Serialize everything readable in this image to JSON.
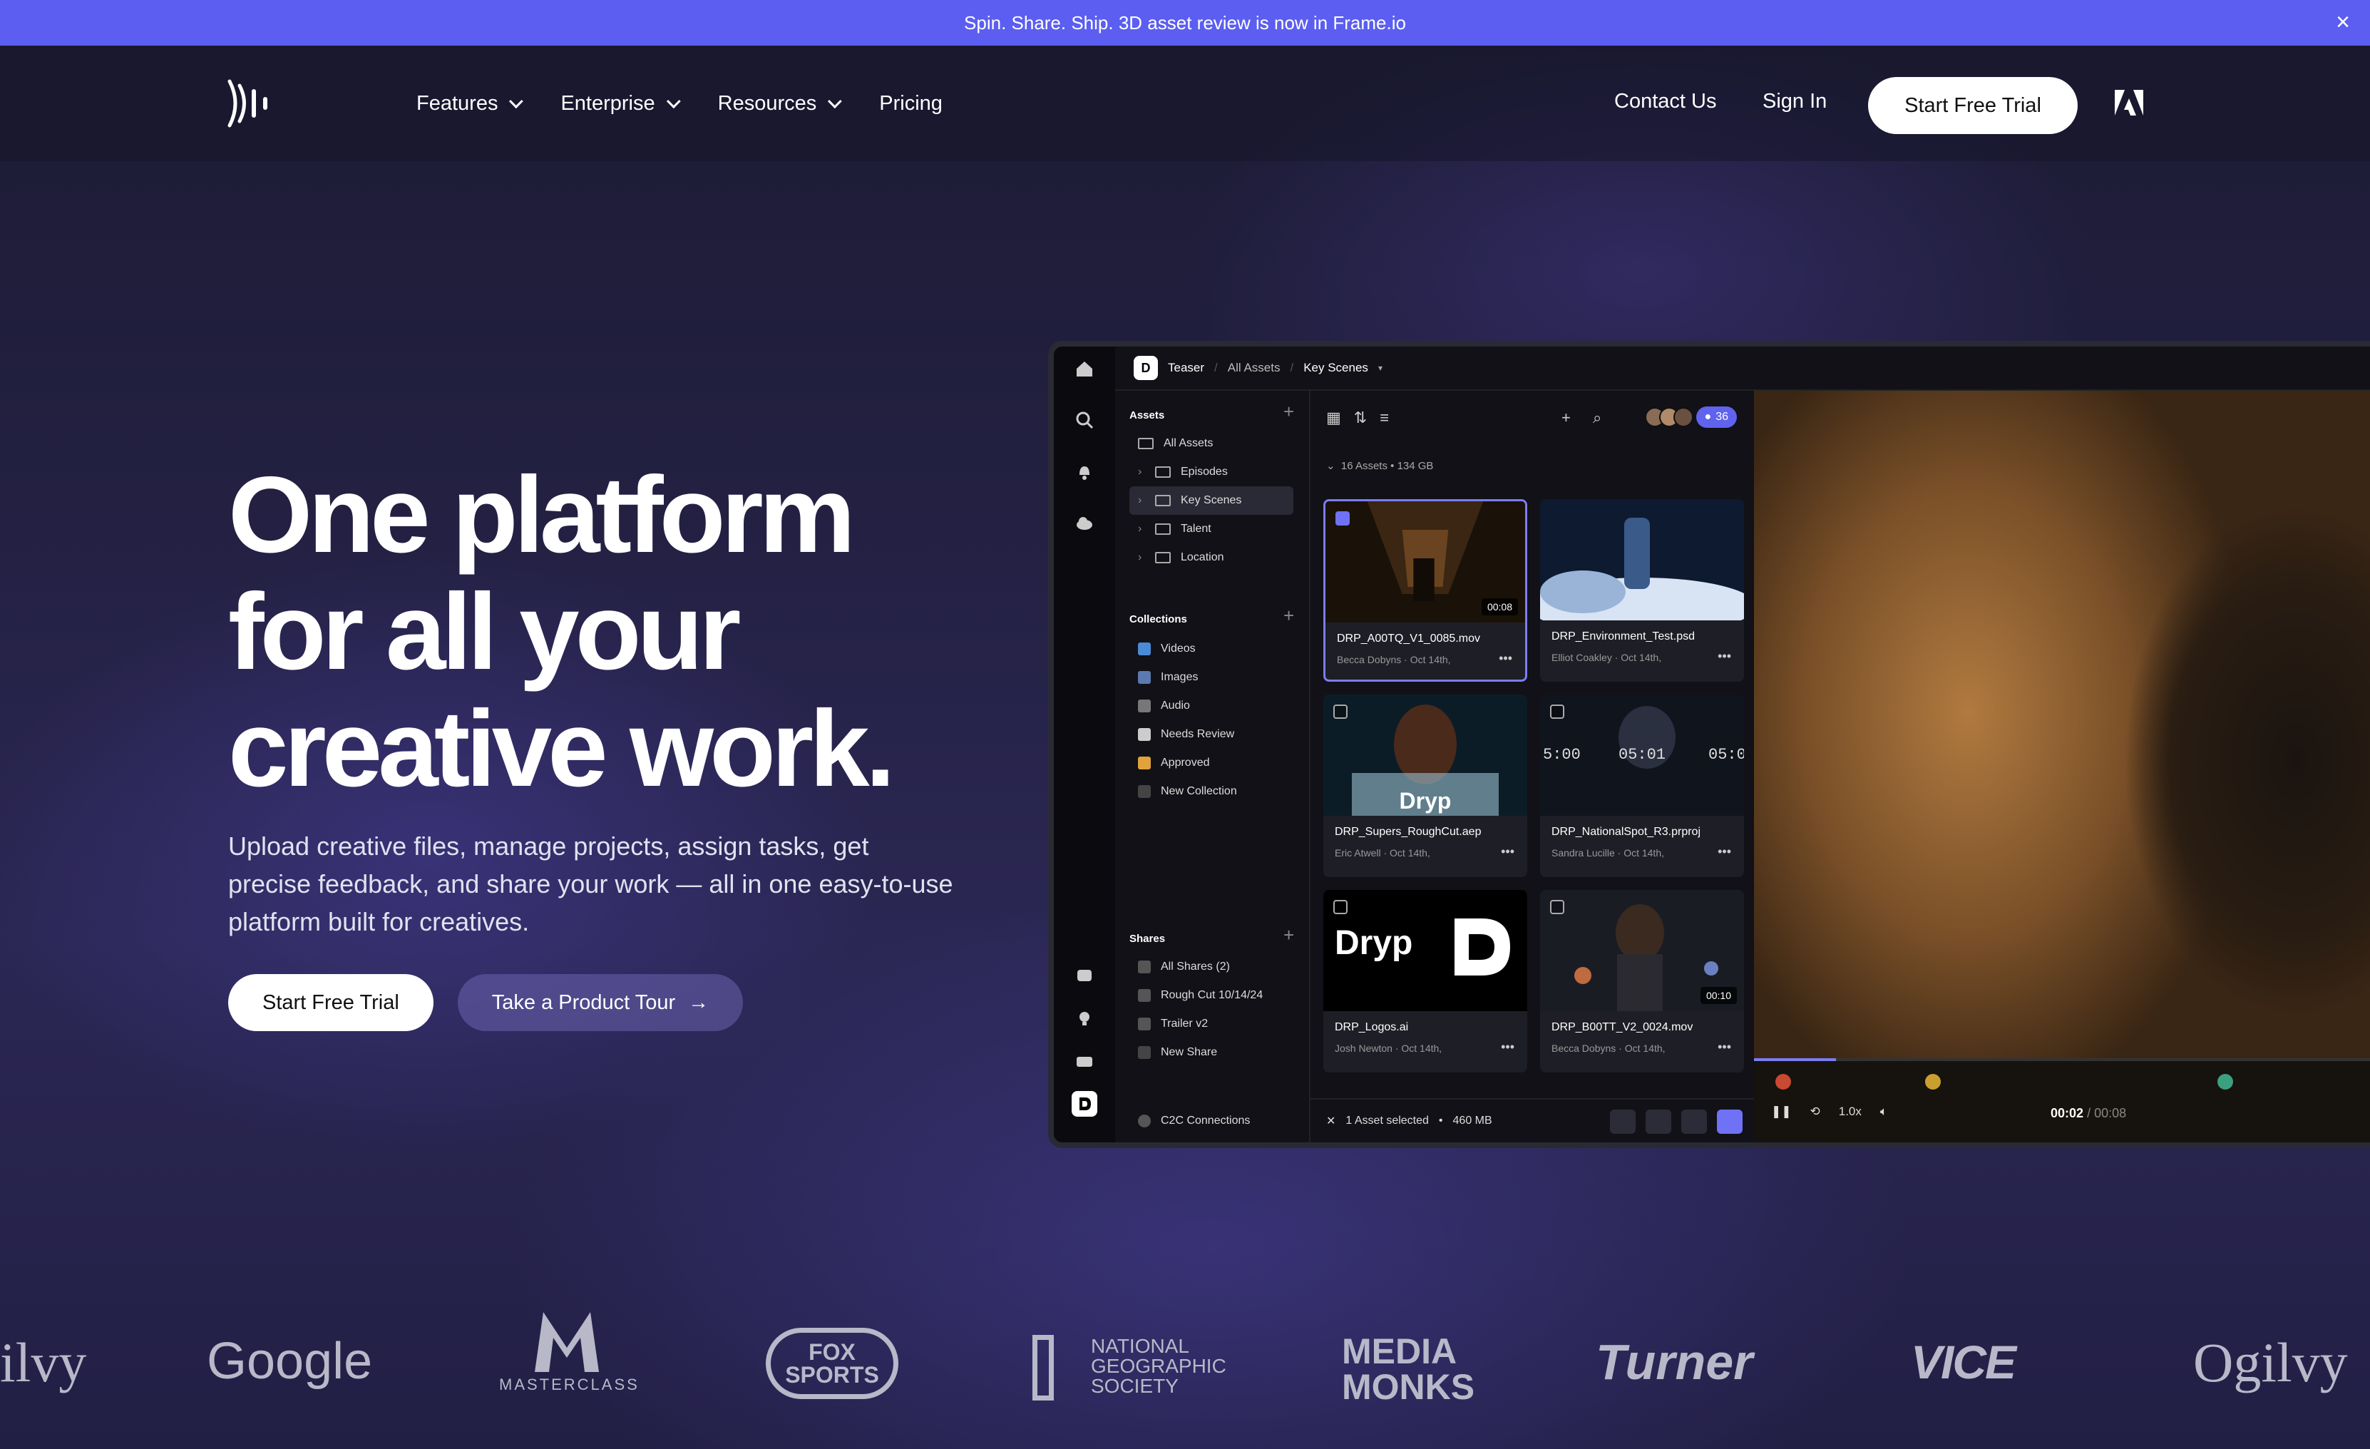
{
  "announcement": {
    "text": "Spin. Share. Ship. 3D asset review is now in Frame.io",
    "close": "×"
  },
  "nav": {
    "links": [
      {
        "label": "Features",
        "has_dropdown": true
      },
      {
        "label": "Enterprise",
        "has_dropdown": true
      },
      {
        "label": "Resources",
        "has_dropdown": true
      },
      {
        "label": "Pricing",
        "has_dropdown": false
      }
    ],
    "contact": "Contact Us",
    "signin": "Sign In",
    "cta": "Start Free Trial",
    "logo_icon": "frameio-logo-icon",
    "adobe_icon": "adobe-logo-icon"
  },
  "hero": {
    "title_lines": [
      "One platform",
      "for all your",
      "creative work."
    ],
    "subtitle": "Upload creative files, manage projects, assign tasks, get precise feedback, and share your work — all in one easy-to-use platform built for creatives.",
    "primary_cta": "Start Free Trial",
    "secondary_cta": "Take a Product Tour",
    "secondary_arrow": "→"
  },
  "app": {
    "breadcrumb": {
      "badge": "D",
      "project": "Teaser",
      "sep": "/",
      "folder": "All Assets",
      "current": "Key Scenes"
    },
    "sidebar": {
      "assets_title": "Assets",
      "assets": [
        {
          "label": "All Assets",
          "selected": false,
          "expandable": false
        },
        {
          "label": "Episodes",
          "selected": false,
          "expandable": true
        },
        {
          "label": "Key Scenes",
          "selected": true,
          "expandable": true
        },
        {
          "label": "Talent",
          "selected": false,
          "expandable": true
        },
        {
          "label": "Location",
          "selected": false,
          "expandable": true
        }
      ],
      "collections_title": "Collections",
      "collections": [
        {
          "label": "Videos",
          "color": "#4a8ad6"
        },
        {
          "label": "Images",
          "color": "#5a7ab0"
        },
        {
          "label": "Audio",
          "color": "#777777"
        },
        {
          "label": "Needs Review",
          "color": "#cccccc"
        },
        {
          "label": "Approved",
          "color": "#e0a23a"
        },
        {
          "label": "New Collection",
          "color": "#444444"
        }
      ],
      "shares_title": "Shares",
      "shares": [
        "All Shares (2)",
        "Rough Cut 10/14/24",
        "Trailer v2",
        "New Share"
      ],
      "c2c": "C2C Connections"
    },
    "grid": {
      "member_count": "36",
      "assets_count": "16 Assets",
      "assets_size": "134 GB",
      "cards": [
        {
          "name": "DRP_A00TQ_V1_0085.mov",
          "author": "Becca Dobyns",
          "date": "Oct 14th,",
          "duration": "00:08",
          "selected": true,
          "thumb": "hallway"
        },
        {
          "name": "DRP_Environment_Test.psd",
          "author": "Elliot Coakley",
          "date": "Oct 14th,",
          "duration": "",
          "selected": false,
          "thumb": "bottle"
        },
        {
          "name": "DRP_Supers_RoughCut.aep",
          "author": "Eric Atwell",
          "date": "Oct 14th,",
          "duration": "",
          "selected": false,
          "thumb": "portrait"
        },
        {
          "name": "DRP_NationalSpot_R3.prproj",
          "author": "Sandra Lucille",
          "date": "Oct 14th,",
          "duration": "",
          "selected": false,
          "thumb": "timer"
        },
        {
          "name": "DRP_Logos.ai",
          "author": "Josh Newton",
          "date": "Oct 14th,",
          "duration": "",
          "selected": false,
          "thumb": "logos"
        },
        {
          "name": "DRP_B00TT_V2_0024.mov",
          "author": "Becca Dobyns",
          "date": "Oct 14th,",
          "duration": "00:10",
          "selected": false,
          "thumb": "street"
        }
      ],
      "thumb_text": {
        "brand": "Dryp",
        "timer_a": "5:00",
        "timer_b": "05:01",
        "timer_c": "05:0"
      },
      "selection": "1 Asset selected",
      "selection_size": "460 MB"
    },
    "viewer": {
      "speed": "1.0x",
      "current_time": "00:02",
      "total_time": "/ 00:08",
      "progress": 0.13
    }
  },
  "logos": [
    "ilvy",
    "Google",
    "MASTERCLASS",
    "FOX SPORTS",
    "NATIONAL GEOGRAPHIC SOCIETY",
    "MEDIA MONKS",
    "Turner",
    "VICE",
    "Ogilvy"
  ]
}
